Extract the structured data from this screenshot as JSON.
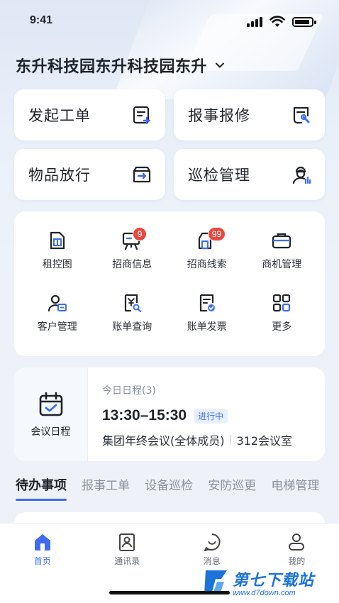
{
  "status_bar": {
    "time": "9:41"
  },
  "header": {
    "title": "东升科技园东升科技园东升"
  },
  "quick_actions": [
    {
      "label": "发起工单",
      "icon": "create-ticket-icon"
    },
    {
      "label": "报事报修",
      "icon": "repair-report-icon"
    },
    {
      "label": "物品放行",
      "icon": "item-release-icon"
    },
    {
      "label": "巡检管理",
      "icon": "inspection-icon"
    }
  ],
  "grid_menu": [
    {
      "label": "租控图",
      "icon": "rent-control-icon"
    },
    {
      "label": "招商信息",
      "icon": "investment-info-icon",
      "badge": "9"
    },
    {
      "label": "招商线索",
      "icon": "investment-leads-icon",
      "badge": "99"
    },
    {
      "label": "商机管理",
      "icon": "opportunity-icon"
    },
    {
      "label": "客户管理",
      "icon": "customer-icon"
    },
    {
      "label": "账单查询",
      "icon": "bill-search-icon"
    },
    {
      "label": "账单发票",
      "icon": "bill-invoice-icon"
    },
    {
      "label": "更多",
      "icon": "more-grid-icon"
    }
  ],
  "schedule": {
    "label": "会议日程",
    "count_text": "今日日程(3)",
    "time": "13:30–15:30",
    "status": "进行中",
    "title": "集团年终会议(全体成员)",
    "room": "312会议室"
  },
  "tabs": [
    "待办事项",
    "报事工单",
    "设备巡检",
    "安防巡更",
    "电梯管理"
  ],
  "bottom_nav": [
    {
      "label": "首页",
      "icon": "home-icon"
    },
    {
      "label": "通讯录",
      "icon": "contacts-icon"
    },
    {
      "label": "消息",
      "icon": "message-icon"
    },
    {
      "label": "我的",
      "icon": "profile-icon"
    }
  ],
  "watermark": {
    "main": "第七下载站",
    "sub": "www.d7down.com"
  },
  "colors": {
    "accent": "#3d6cf2",
    "badge": "#e8473f",
    "text": "#1f2329"
  }
}
